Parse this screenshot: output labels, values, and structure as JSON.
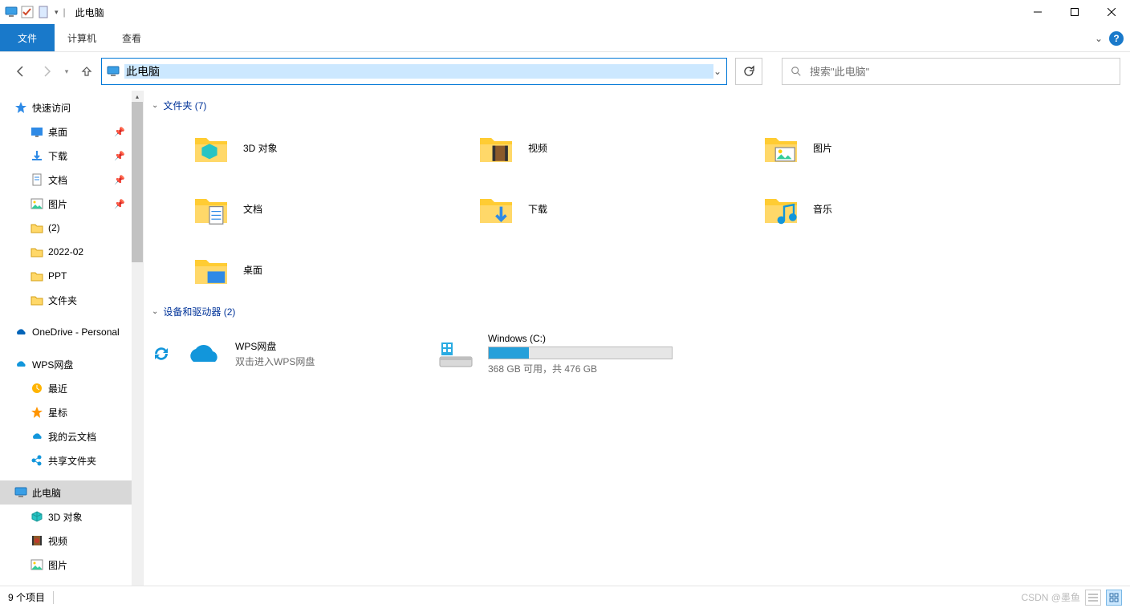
{
  "window": {
    "title": "此电脑",
    "separator": "|"
  },
  "ribbon": {
    "file": "文件",
    "tabs": [
      "计算机",
      "查看"
    ]
  },
  "nav": {
    "address": "此电脑",
    "search_placeholder": "搜索\"此电脑\""
  },
  "sidebar": {
    "quick_access": "快速访问",
    "quick_items": [
      {
        "label": "桌面",
        "pinned": true,
        "icon": "desktop"
      },
      {
        "label": "下载",
        "pinned": true,
        "icon": "download"
      },
      {
        "label": "文档",
        "pinned": true,
        "icon": "document"
      },
      {
        "label": "图片",
        "pinned": true,
        "icon": "picture"
      },
      {
        "label": "(2)",
        "pinned": false,
        "icon": "folder"
      },
      {
        "label": "2022-02",
        "pinned": false,
        "icon": "folder"
      },
      {
        "label": "PPT",
        "pinned": false,
        "icon": "folder"
      },
      {
        "label": "文件夹",
        "pinned": false,
        "icon": "folder"
      }
    ],
    "onedrive": "OneDrive - Personal",
    "wps": "WPS网盘",
    "wps_items": [
      {
        "label": "最近",
        "icon": "clock"
      },
      {
        "label": "星标",
        "icon": "star"
      },
      {
        "label": "我的云文档",
        "icon": "cloud"
      },
      {
        "label": "共享文件夹",
        "icon": "share"
      }
    ],
    "this_pc": "此电脑",
    "pc_items": [
      {
        "label": "3D 对象",
        "icon": "3d"
      },
      {
        "label": "视频",
        "icon": "video"
      },
      {
        "label": "图片",
        "icon": "picture"
      }
    ]
  },
  "groups": {
    "folders_header": "文件夹 (7)",
    "folders": [
      {
        "label": "3D 对象",
        "icon": "3d"
      },
      {
        "label": "视频",
        "icon": "video"
      },
      {
        "label": "图片",
        "icon": "picture"
      },
      {
        "label": "文档",
        "icon": "document"
      },
      {
        "label": "下载",
        "icon": "download"
      },
      {
        "label": "音乐",
        "icon": "music"
      },
      {
        "label": "桌面",
        "icon": "desktop"
      }
    ],
    "drives_header": "设备和驱动器 (2)",
    "wps": {
      "title": "WPS网盘",
      "sub": "双击进入WPS网盘"
    },
    "cdrive": {
      "title": "Windows (C:)",
      "sub": "368 GB 可用，共 476 GB",
      "fill_pct": 22
    }
  },
  "status": {
    "left": "9 个项目",
    "right": "CSDN @墨鱼"
  }
}
